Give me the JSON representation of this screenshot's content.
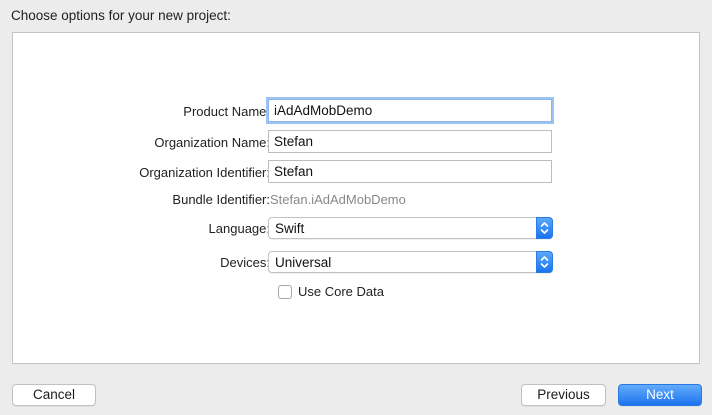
{
  "dialog": {
    "heading": "Choose options for your new project:"
  },
  "form": {
    "product_name": {
      "label": "Product Name:",
      "value": "iAdAdMobDemo"
    },
    "organization_name": {
      "label": "Organization Name:",
      "value": "Stefan"
    },
    "organization_identifier": {
      "label": "Organization Identifier:",
      "value": "Stefan"
    },
    "bundle_identifier": {
      "label": "Bundle Identifier:",
      "value": "Stefan.iAdAdMobDemo"
    },
    "language": {
      "label": "Language:",
      "selected": "Swift"
    },
    "devices": {
      "label": "Devices:",
      "selected": "Universal"
    },
    "use_core_data": {
      "label": "Use Core Data",
      "checked": false
    }
  },
  "buttons": {
    "cancel": "Cancel",
    "previous": "Previous",
    "next": "Next"
  },
  "colors": {
    "accent": "#1c73ef",
    "focus_ring": "#9cc3f3",
    "background": "#ececec"
  },
  "icons": {
    "popup_arrows": "chevron-up-down-icon"
  }
}
